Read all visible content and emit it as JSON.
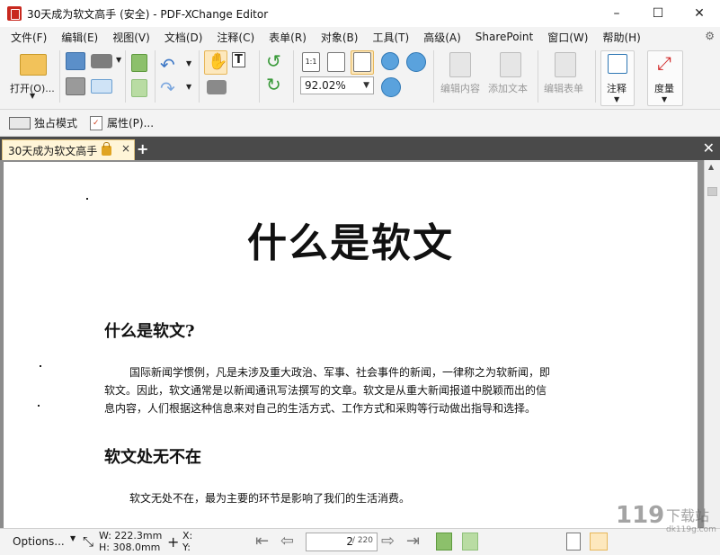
{
  "window": {
    "title": "30天成为软文高手 (安全) - PDF-XChange Editor",
    "minimize": "–",
    "maximize": "☐",
    "close": "✕"
  },
  "menu": [
    "文件(F)",
    "编辑(E)",
    "视图(V)",
    "文档(D)",
    "注释(C)",
    "表单(R)",
    "对象(B)",
    "工具(T)",
    "高级(A)",
    "SharePoint",
    "窗口(W)",
    "帮助(H)"
  ],
  "toolbar": {
    "open_label": "打开(O)...",
    "zoom_value": "92.02%",
    "edit_content_label": "编辑内容",
    "add_text_label": "添加文本",
    "edit_form_label": "编辑表单",
    "annotate_label": "注释",
    "measure_label": "度量"
  },
  "subbar": {
    "exclusive_mode": "独占模式",
    "properties": "属性(P)..."
  },
  "tabs": [
    {
      "label": "30天成为软文高手",
      "secure": true
    }
  ],
  "document": {
    "title": "什么是软文",
    "sections": [
      {
        "heading": "什么是软文?",
        "lines": [
          "国际新闻学惯例，凡是未涉及重大政治、军事、社会事件的新闻，一律称之为软新闻，即",
          "软文。因此，软文通常是以新闻通讯写法撰写的文章。软文是从重大新闻报道中脱颖而出的信",
          "息内容，人们根据这种信息来对自己的生活方式、工作方式和采购等行动做出指导和选择。"
        ]
      },
      {
        "heading": "软文处无不在",
        "lines": [
          "软文无处不在，最为主要的环节是影响了我们的生活消费。"
        ]
      }
    ]
  },
  "status": {
    "options": "Options...",
    "width": "W: 222.3mm",
    "height": "H: 308.0mm",
    "x": "X:",
    "y": "Y:",
    "current_page": "2",
    "total_pages": "/ 220"
  },
  "watermark": "下载站",
  "watermark_url": "dk119g.com"
}
